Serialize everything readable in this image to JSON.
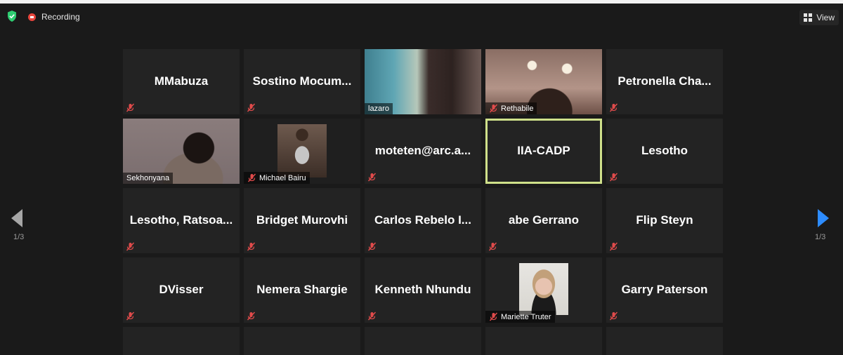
{
  "recording_label": "Recording",
  "view_label": "View",
  "pagination": {
    "current": "1/3"
  },
  "participants": [
    {
      "name": "MMabuza",
      "video": false,
      "muted": true
    },
    {
      "name": "Sostino Mocum...",
      "video": false,
      "muted": true
    },
    {
      "name": "lazaro",
      "video": true,
      "muted": false
    },
    {
      "name": "Rethabile",
      "video": true,
      "muted": true
    },
    {
      "name": "Petronella Cha...",
      "video": false,
      "muted": true
    },
    {
      "name": "Sekhonyana",
      "video": true,
      "muted": false
    },
    {
      "name": "Michael Bairu",
      "video": true,
      "muted": true
    },
    {
      "name": "moteten@arc.a...",
      "video": false,
      "muted": true
    },
    {
      "name": "IIA-CADP",
      "video": false,
      "muted": false,
      "active_speaker": true
    },
    {
      "name": "Lesotho",
      "video": false,
      "muted": true
    },
    {
      "name": "Lesotho, Ratsoa...",
      "video": false,
      "muted": true
    },
    {
      "name": "Bridget Murovhi",
      "video": false,
      "muted": true
    },
    {
      "name": "Carlos Rebelo I...",
      "video": false,
      "muted": true
    },
    {
      "name": "abe Gerrano",
      "video": false,
      "muted": true
    },
    {
      "name": "Flip Steyn",
      "video": false,
      "muted": true
    },
    {
      "name": "DVisser",
      "video": false,
      "muted": true
    },
    {
      "name": "Nemera Shargie",
      "video": false,
      "muted": true
    },
    {
      "name": "Kenneth Nhundu",
      "video": false,
      "muted": true
    },
    {
      "name": "Mariette Truter",
      "video": true,
      "muted": true
    },
    {
      "name": "Garry Paterson",
      "video": false,
      "muted": true
    }
  ],
  "icons": {
    "security": "shield-check-icon",
    "recording": "record-icon",
    "view": "grid-icon",
    "muted": "mic-muted-icon",
    "prev": "chevron-left-icon",
    "next": "chevron-right-icon"
  },
  "colors": {
    "background": "#1a1a1a",
    "tile": "#232323",
    "active_speaker_border": "#cfe08a",
    "muted_icon": "#e14b4b",
    "shield": "#2ecc71",
    "record": "#e8453c",
    "next_arrow": "#2d8cff"
  }
}
